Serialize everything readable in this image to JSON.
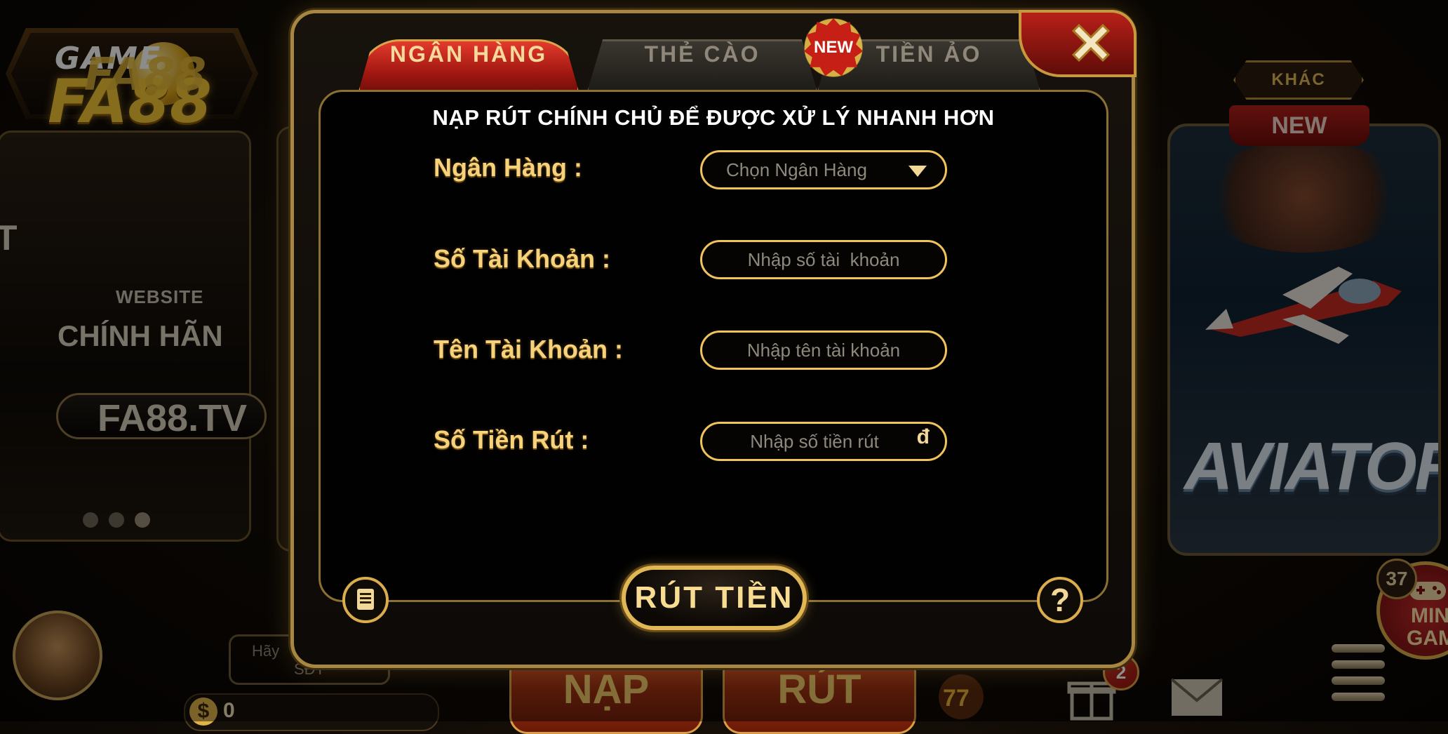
{
  "background": {
    "logo": {
      "top_text": "GAME",
      "main_text": "FA88"
    },
    "left_panel": {
      "logo_text": "FA88",
      "website_label": "WEBSITE",
      "headline": "CHÍNH HÃN",
      "domain": "FA88.TV",
      "edge_letter": "T"
    },
    "right_panel": {
      "category_badge": "KHÁC",
      "new_ribbon": "NEW",
      "game_title": "AVIATOR"
    },
    "mini_game": {
      "badge_count": "37",
      "label_line1": "MIN",
      "label_line2": "GAM"
    },
    "bottom_bar": {
      "phone_hint_line1": "Hãy",
      "phone_hint_line2": "SĐT",
      "balance": "0",
      "deposit_label": "NẠP",
      "withdraw_label": "RÚT",
      "gift_badge": "2"
    }
  },
  "modal": {
    "tabs": [
      {
        "label": "NGÂN HÀNG",
        "active": true
      },
      {
        "label": "THẺ CÀO",
        "active": false
      },
      {
        "label": "TIỀN ẢO",
        "active": false
      }
    ],
    "new_badge": "NEW",
    "title": "NẠP RÚT CHÍNH CHỦ ĐỂ ĐƯỢC XỬ LÝ NHANH HƠN",
    "form": {
      "bank": {
        "label": "Ngân Hàng :",
        "placeholder": "Chọn Ngân Hàng"
      },
      "account_number": {
        "label": "Số Tài Khoản :",
        "placeholder": "Nhập số tài  khoản"
      },
      "account_name": {
        "label": "Tên Tài Khoản :",
        "placeholder": "Nhập tên tài khoản"
      },
      "amount": {
        "label": "Số Tiền Rút :",
        "placeholder": "Nhập số tiền rút",
        "currency": "đ"
      }
    },
    "submit_label": "RÚT TIỀN",
    "help_label": "?"
  },
  "colors": {
    "gold": "#f0c35b",
    "label_gold": "#f7d27a",
    "tab_red": "#c0221a",
    "placeholder": "#8f887c"
  },
  "icons": [
    "close-icon",
    "dropdown-caret-icon",
    "history-icon",
    "help-icon",
    "gamepad-icon",
    "menu-icon",
    "mail-icon",
    "gift-icon",
    "coin-icon"
  ]
}
